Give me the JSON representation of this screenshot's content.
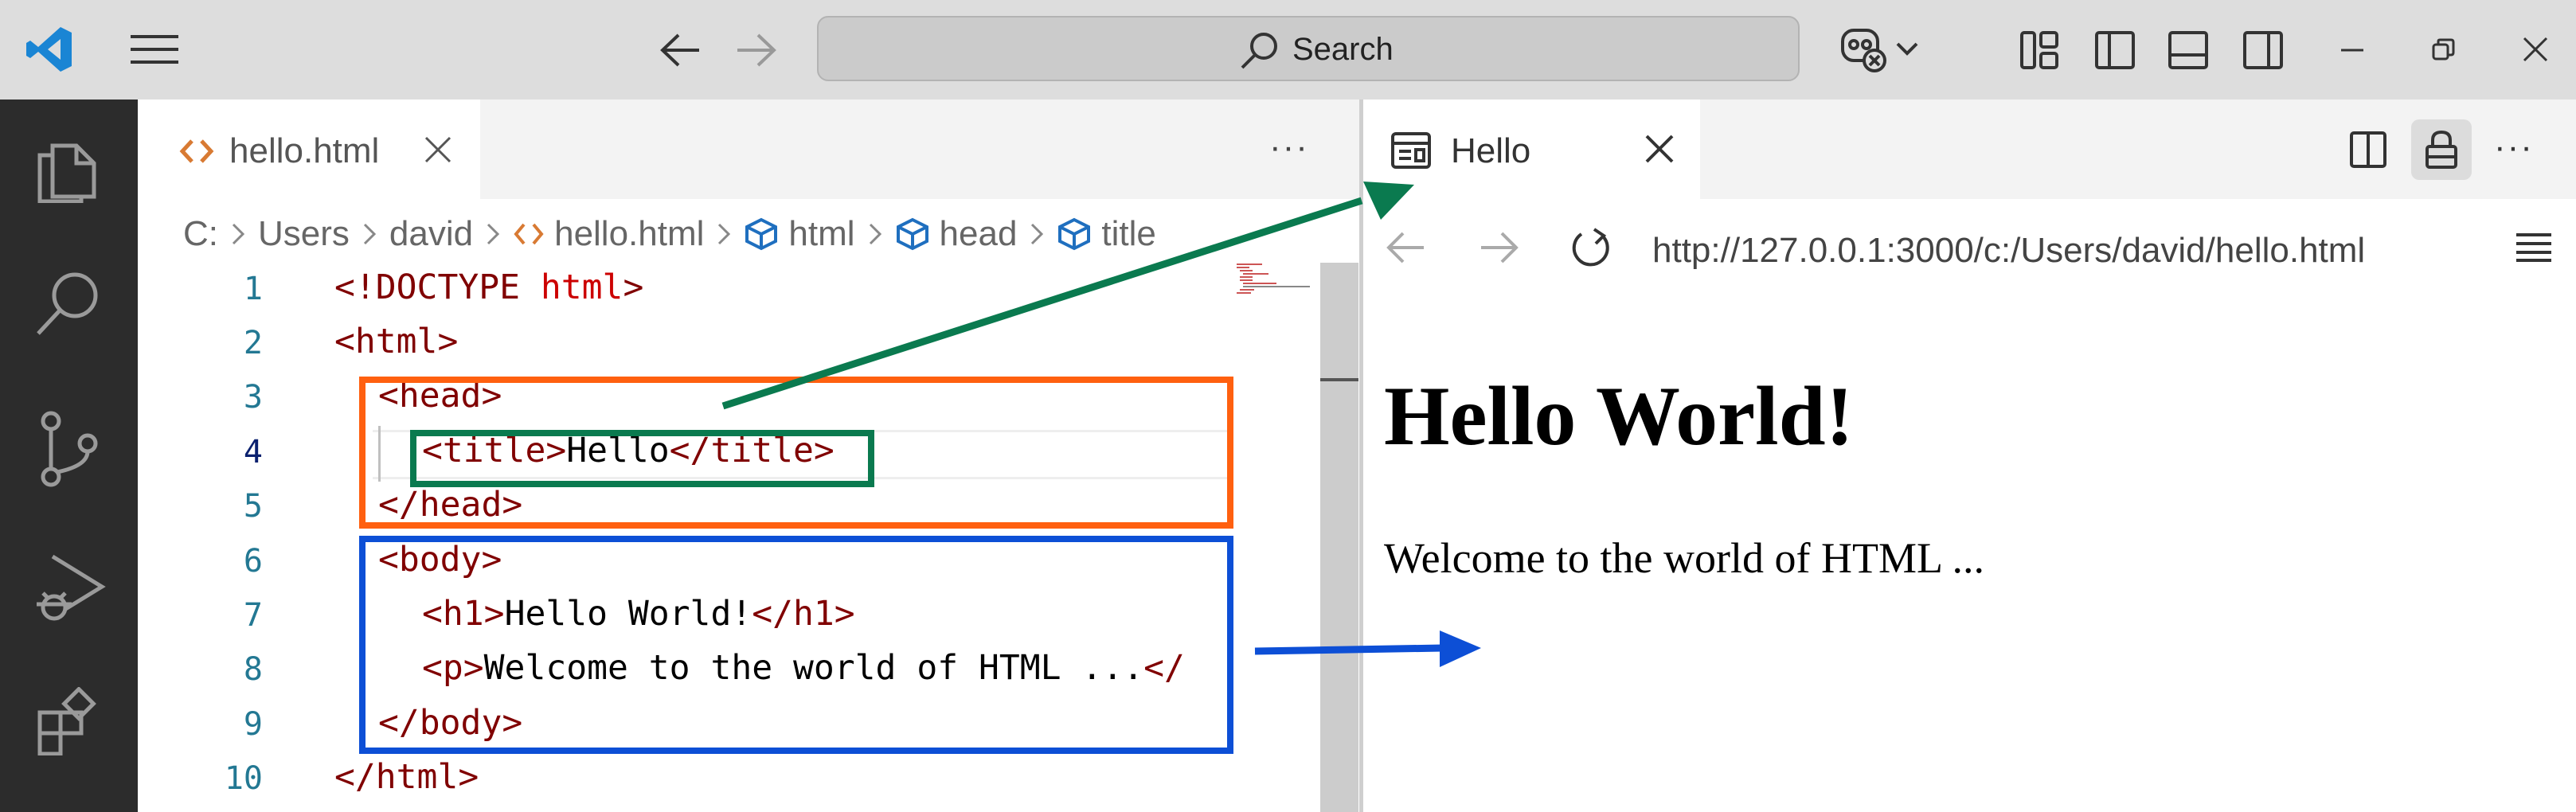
{
  "titlebar": {
    "search_label": "Search",
    "icons": [
      "vscode-logo-icon",
      "menu-icon",
      "back-arrow-icon",
      "forward-arrow-icon",
      "search-icon",
      "copilot-icon",
      "chevron-down-icon",
      "customize-layout-icon",
      "toggle-sidebar-icon",
      "toggle-panel-icon",
      "toggle-secondary-sidebar-icon",
      "minimize-icon",
      "restore-icon",
      "close-icon"
    ]
  },
  "activitybar": {
    "items": [
      "explorer-icon",
      "search-icon",
      "source-control-icon",
      "run-debug-icon",
      "extensions-icon"
    ]
  },
  "editor": {
    "tab": {
      "name": "hello.html"
    },
    "more_actions": "···",
    "breadcrumb": [
      {
        "label": "C:"
      },
      {
        "label": "Users"
      },
      {
        "label": "david"
      },
      {
        "label": "hello.html",
        "icon": "html-file-icon"
      },
      {
        "label": "html",
        "icon": "symbol-element-icon"
      },
      {
        "label": "head",
        "icon": "symbol-element-icon"
      },
      {
        "label": "title",
        "icon": "symbol-element-icon"
      }
    ],
    "line_numbers": [
      "1",
      "2",
      "3",
      "4",
      "5",
      "6",
      "7",
      "8",
      "9",
      "10"
    ],
    "code": {
      "l1_tag": "<!DOCTYPE",
      "l1_kw": " html",
      "l1_end": ">",
      "l2": "<html>",
      "l3": "<head>",
      "l4_open": "<title>",
      "l4_text": "Hello",
      "l4_close": "</title>",
      "l5": "</head>",
      "l6": "<body>",
      "l7_open": "<h1>",
      "l7_text": "Hello World!",
      "l7_close": "</h1>",
      "l8_open": "<p>",
      "l8_text": "Welcome to the world of HTML ...",
      "l8_close": "</",
      "l9": "</body>",
      "l10": "</html>"
    }
  },
  "preview": {
    "tab": {
      "name": "Hello"
    },
    "url": "http://127.0.0.1:3000/c:/Users/david/hello.html",
    "page": {
      "h1": "Hello World!",
      "p": "Welcome to the world of HTML ..."
    }
  },
  "annotations": {
    "colors": {
      "head": "#ff6010",
      "title": "#0a7a4f",
      "body": "#0d4fd6"
    }
  }
}
